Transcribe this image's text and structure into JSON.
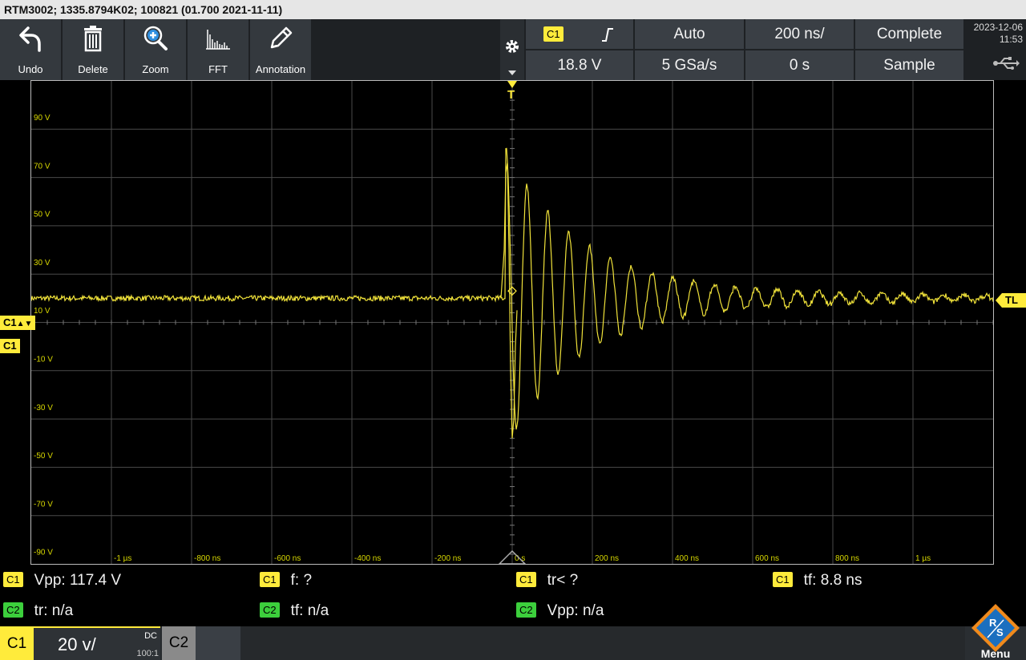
{
  "title_bar": "RTM3002; 1335.8794K02; 100821 (01.700 2021-11-11)",
  "toolbar": {
    "tools": [
      "Undo",
      "Delete",
      "Zoom",
      "FFT",
      "Annotation"
    ]
  },
  "trigger": {
    "source": "C1",
    "slope_icon": "rising-edge-icon",
    "mode": "Auto",
    "timebase": "200 ns/",
    "acq_state": "Complete",
    "level": "18.8 V",
    "sample_rate": "5 GSa/s",
    "position": "0 s",
    "acq_mode": "Sample"
  },
  "datetime": {
    "date": "2023-12-06",
    "time": "11:53"
  },
  "plot": {
    "y_labels": [
      "90 V",
      "70 V",
      "50 V",
      "30 V",
      "10 V",
      "-10 V",
      "-30 V",
      "-50 V",
      "-70 V",
      "-90 V"
    ],
    "x_labels": [
      "-1 µs",
      "-800 ns",
      "-600 ns",
      "-400 ns",
      "-200 ns",
      "0 s",
      "200 ns",
      "400 ns",
      "600 ns",
      "800 ns",
      "1 µs"
    ],
    "trigger_marker": "T",
    "trigger_level_marker": "TL",
    "channel_marker": "C1",
    "trace_color": "#f0e23a"
  },
  "measurements": {
    "row1": [
      {
        "ch": "C1",
        "text": "Vpp: 117.4 V"
      },
      {
        "ch": "C1",
        "text": "f: ?"
      },
      {
        "ch": "C1",
        "text": "tr< ?"
      },
      {
        "ch": "C1",
        "text": "tf: 8.8 ns"
      }
    ],
    "row2": [
      {
        "ch": "C2",
        "text": "tr: n/a"
      },
      {
        "ch": "C2",
        "text": "tf: n/a"
      },
      {
        "ch": "C2",
        "text": "Vpp: n/a"
      }
    ]
  },
  "channels": {
    "c1": {
      "label": "C1",
      "scale": "20 v/",
      "coupling": "DC",
      "impedance": "100:1"
    },
    "c2": {
      "label": "C2"
    }
  },
  "menu_label": "Menu",
  "colors": {
    "ch1": "#ffeb3b",
    "ch2": "#3ccf3c",
    "grid": "#4a4a4a"
  }
}
